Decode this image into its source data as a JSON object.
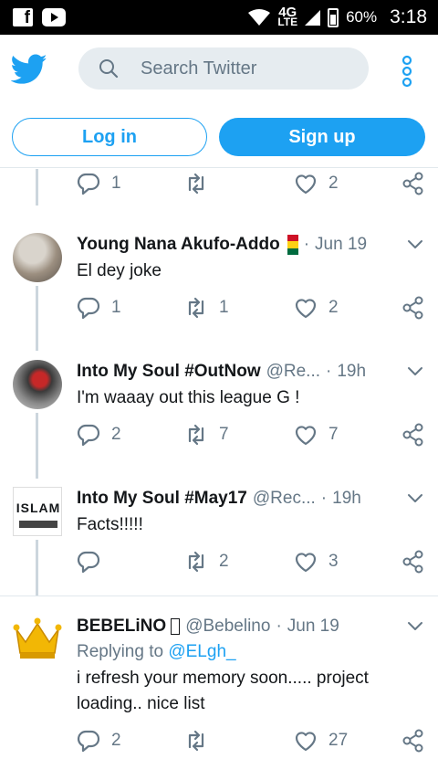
{
  "status_bar": {
    "network": "4G",
    "network_sub": "LTE",
    "battery": "60%",
    "time": "3:18"
  },
  "header": {
    "logo_icon": "twitter-bird-icon",
    "search_placeholder": "Search Twitter",
    "login_label": "Log in",
    "signup_label": "Sign up",
    "brand_color": "#1da1f2"
  },
  "top_actions": {
    "reply": "1",
    "retweet": "",
    "like": "2"
  },
  "tweets": [
    {
      "name": "Young Nana Akufo-Addo",
      "handle": "",
      "time": "Jun 19",
      "text": "El dey joke",
      "reply": "1",
      "retweet": "1",
      "like": "2"
    },
    {
      "name": "Into My Soul #OutNow",
      "handle": "@Re...",
      "time": "19h",
      "text": "I'm waaay out this league G !",
      "reply": "2",
      "retweet": "7",
      "like": "7"
    },
    {
      "name": "Into My Soul #May17",
      "handle": "@Rec...",
      "time": "19h",
      "text": "Facts!!!!!",
      "reply": "",
      "retweet": "2",
      "like": "3",
      "avatar_text": "ISLAM"
    },
    {
      "name": "BEBELiNO",
      "handle": "@Bebelino",
      "time": "Jun 19",
      "replying_prefix": "Replying to",
      "replying_to": "@ELgh_",
      "text": "i refresh your memory soon..... project loading.. nice list",
      "reply": "2",
      "retweet": "",
      "like": "27"
    }
  ]
}
